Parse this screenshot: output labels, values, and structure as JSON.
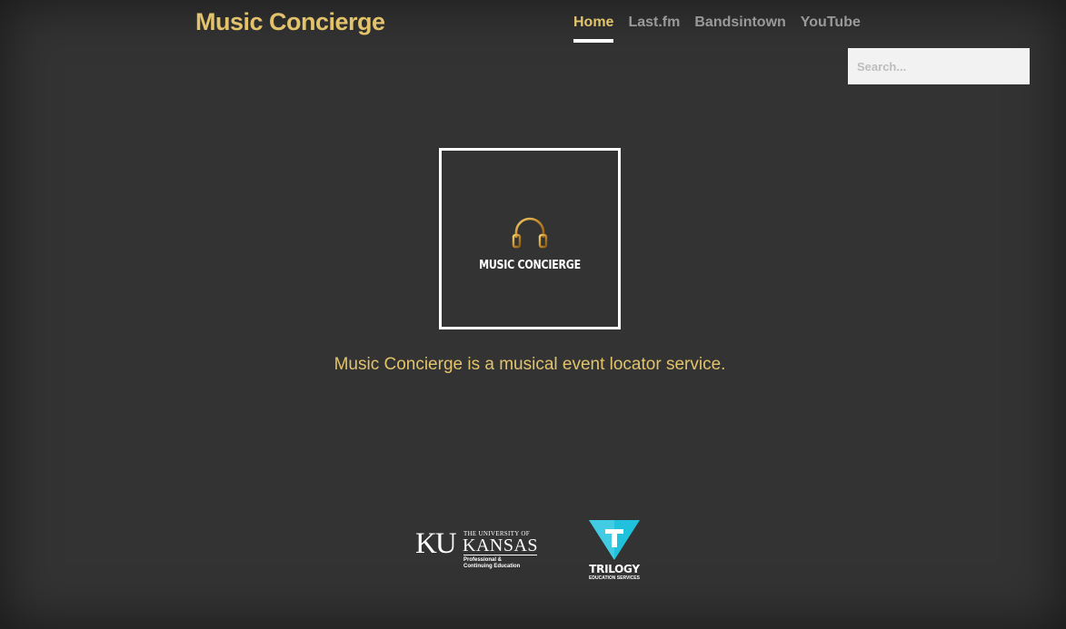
{
  "header": {
    "brand": "Music Concierge",
    "nav": [
      {
        "label": "Home",
        "active": true
      },
      {
        "label": "Last.fm",
        "active": false
      },
      {
        "label": "Bandsintown",
        "active": false
      },
      {
        "label": "YouTube",
        "active": false
      }
    ],
    "search": {
      "placeholder": "Search...",
      "value": ""
    }
  },
  "hero": {
    "logo_text": "MUSIC CONCIERGE",
    "logo_icon": "headphones-icon",
    "tagline": "Music Concierge is a musical event locator service."
  },
  "footer": {
    "ku": {
      "initials": "KU",
      "line1": "THE UNIVERSITY OF",
      "line2": "KANSAS",
      "sub1": "Professional &",
      "sub2": "Continuing Education"
    },
    "trilogy": {
      "letter": "T",
      "name": "TRILOGY",
      "sub": "EDUCATION SERVICES"
    }
  },
  "colors": {
    "background": "#333333",
    "accent": "#e2c36b",
    "nav_inactive": "#9a9a9a",
    "trilogy_teal": "#1fc1dc"
  }
}
